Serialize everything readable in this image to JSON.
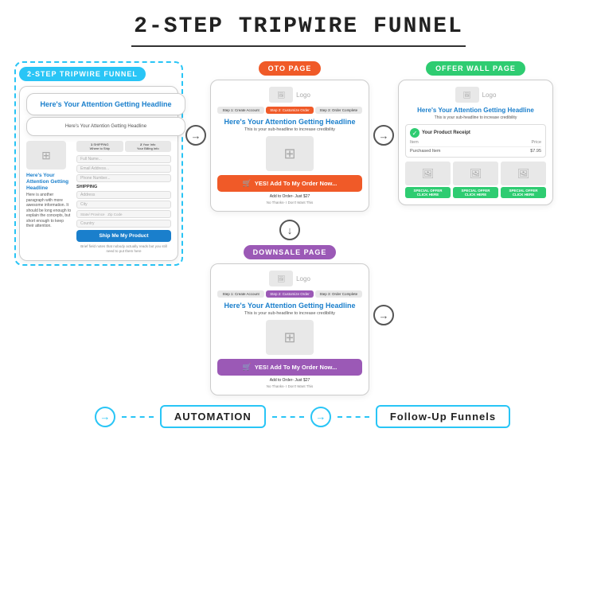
{
  "title": "2-STEP TRIPWIRE FUNNEL",
  "left_panel": {
    "label": "2-STEP TRIPWIRE FUNNEL",
    "card": {
      "headline": "Here's Your Attention Getting Headline",
      "subheadline": "Here's Your Attention Getting Headline",
      "steps": [
        {
          "label": "1 SHIPPING\nWhere to Ship",
          "active": false
        },
        {
          "label": "2 Your Info\nYour Billing Info",
          "active": false
        }
      ],
      "fields": [
        "Full Name...",
        "Email Address...",
        "Phone Number...",
        "Address",
        "City",
        "State/ Province   Zip Code",
        "Country"
      ],
      "shipping_label": "SHIPPING",
      "cta_button": "Ship Me My Product",
      "bottom_text": "Brief field notes that nobody actually reads but you still need to put them here"
    },
    "sidebar": {
      "headline": "Here's Your Attention Getting Headline",
      "body": "Here is another paragraph with more awesome information. It should be long enough to explain the concepts, but short enough to keep their attention."
    }
  },
  "oto_page": {
    "label": "OTO PAGE",
    "logo_text": "Logo",
    "steps": [
      {
        "label": "Step 1: Create Account",
        "active": false
      },
      {
        "label": "Step 2: Customize Order",
        "active": true
      },
      {
        "label": "Step 3: Order Complete",
        "active": false
      }
    ],
    "headline": "Here's Your Attention Getting Headline",
    "sub": "This is your sub-headline to increase credibility",
    "cta_button": "YES! Add To My Order Now...",
    "add_text": "Add to Order- Just $27",
    "no_thanks": "No Thanks- I Don't Want This"
  },
  "downsale_page": {
    "label": "DOWNSALE PAGE",
    "logo_text": "Logo",
    "steps": [
      {
        "label": "Step 1: Create Account",
        "active": false
      },
      {
        "label": "Step 2: Customize Order",
        "active": true
      },
      {
        "label": "Step 3: Order Complete",
        "active": false
      }
    ],
    "headline": "Here's Your Attention Getting Headline",
    "sub": "This is your sub-headline to increase credibility",
    "cta_button": "YES! Add To My Order Now...",
    "add_text": "Add to Order- Just $27",
    "no_thanks": "No Thanks- I Don't Want This"
  },
  "offer_wall_page": {
    "label": "OFFER WALL PAGE",
    "logo_text": "Logo",
    "headline": "Here's Your Attention Getting Headline",
    "sub": "This is your sub-headline to increase credibility",
    "receipt": {
      "title": "Your Product Receipt",
      "item_col": "Item",
      "price_col": "Price",
      "item": "Purchased Item",
      "price": "$7.95"
    },
    "offers": [
      {
        "label": "SPECIAL OFFER\nCLICK HERE"
      },
      {
        "label": "SPECIAL OFFER\nCLICK HERE"
      },
      {
        "label": "SPECIAL OFFER\nCLICK HERE"
      }
    ]
  },
  "bottom": {
    "arrow_label": "→",
    "automation_label": "AUTOMATION",
    "followup_label": "Follow-Up Funnels"
  }
}
